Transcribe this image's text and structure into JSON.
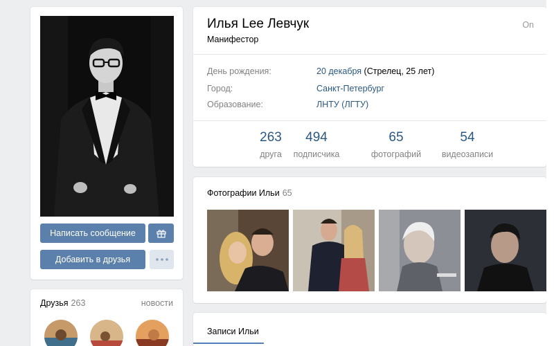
{
  "profile": {
    "name": "Илья Lee Левчук",
    "status": "Манифестор",
    "online": "On",
    "info": [
      {
        "label": "День рождения:",
        "value": "20 декабря",
        "extra": " (Стрелец, 25 лет)"
      },
      {
        "label": "Город:",
        "value": "Санкт-Петербург",
        "extra": ""
      },
      {
        "label": "Образование:",
        "value": "ЛНТУ (ЛГТУ)",
        "extra": ""
      }
    ],
    "counters": [
      {
        "num": "263",
        "label": "друга"
      },
      {
        "num": "494",
        "label": "подписчика"
      },
      {
        "num": "65",
        "label": "фотографий"
      },
      {
        "num": "54",
        "label": "видеозаписи"
      }
    ]
  },
  "actions": {
    "message": "Написать сообщение",
    "add_friend": "Добавить в друзья",
    "gift_icon": "gift-icon",
    "more_icon": "more-icon"
  },
  "friends": {
    "title": "Друзья",
    "count": "263",
    "news": "новости"
  },
  "photos": {
    "title": "Фотографии Ильи",
    "count": "65"
  },
  "posts": {
    "tab": "Записи Ильи"
  },
  "colors": {
    "accent": "#5b80ab",
    "link": "#2a5885",
    "muted": "#828282",
    "background": "#edeef0"
  }
}
